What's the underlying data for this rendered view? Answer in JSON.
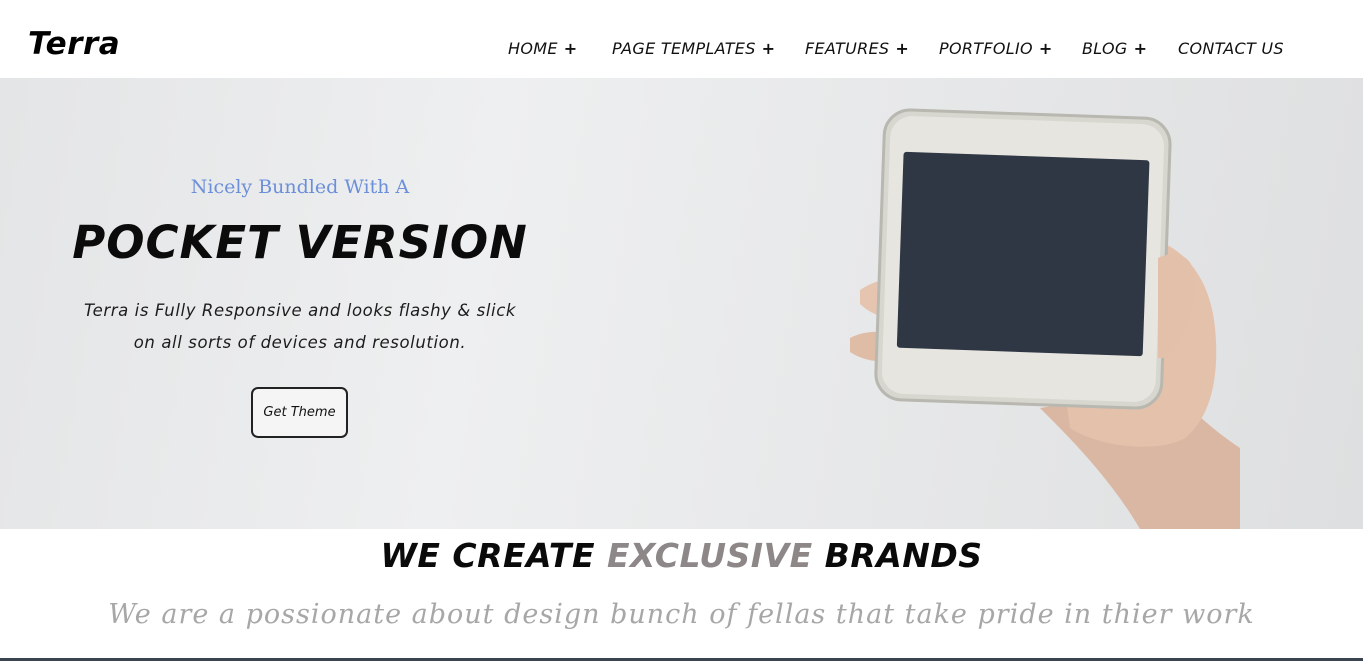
{
  "header": {
    "logo": "Terra",
    "nav": [
      {
        "label": "HOME",
        "has_submenu": true
      },
      {
        "label": "PAGE TEMPLATES",
        "has_submenu": true
      },
      {
        "label": "FEATURES",
        "has_submenu": true
      },
      {
        "label": "PORTFOLIO",
        "has_submenu": true
      },
      {
        "label": "BLOG",
        "has_submenu": true
      },
      {
        "label": "CONTACT US",
        "has_submenu": false
      }
    ],
    "submenu_symbol": "+"
  },
  "hero": {
    "kicker": "Nicely Bundled With A",
    "title": "POCKET VERSION",
    "desc_line1": "Terra is Fully Responsive and looks flashy & slick",
    "desc_line2": "on all sorts of devices and resolution.",
    "button": "Get Theme",
    "kicker_color": "#6b8fd9"
  },
  "section": {
    "title_part1": "WE CREATE ",
    "title_accent": "EXCLUSIVE",
    "title_part2": " BRANDS",
    "subtitle": "We are a possionate about design bunch of fellas that take pride in thier work",
    "accent_color": "#8d8787"
  }
}
